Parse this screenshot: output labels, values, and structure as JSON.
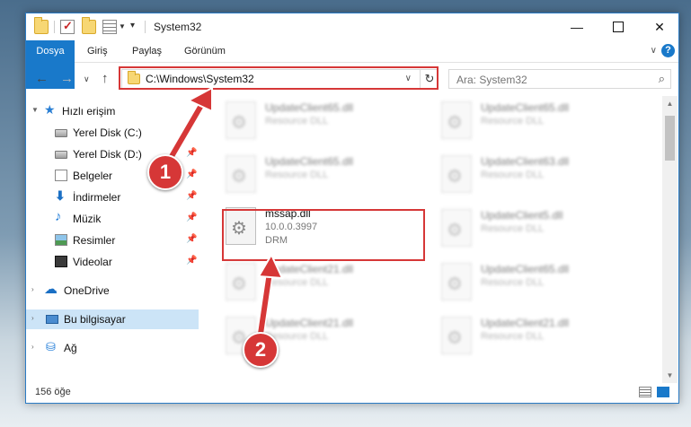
{
  "window": {
    "title": "System32"
  },
  "ribbon": {
    "tabs": [
      "Dosya",
      "Giriş",
      "Paylaş",
      "Görünüm"
    ],
    "help": "?"
  },
  "nav": {
    "address": "C:\\Windows\\System32",
    "search_placeholder": "Ara: System32"
  },
  "sidebar": {
    "items": [
      {
        "label": "Hızlı erişim",
        "icon": "star-icon"
      },
      {
        "label": "Yerel Disk (C:)",
        "icon": "disk-icon"
      },
      {
        "label": "Yerel Disk (D:)",
        "icon": "disk-icon"
      },
      {
        "label": "Belgeler",
        "icon": "document-icon"
      },
      {
        "label": "İndirmeler",
        "icon": "download-icon"
      },
      {
        "label": "Müzik",
        "icon": "music-icon"
      },
      {
        "label": "Resimler",
        "icon": "pictures-icon"
      },
      {
        "label": "Videolar",
        "icon": "video-icon"
      },
      {
        "label": "OneDrive",
        "icon": "cloud-icon"
      },
      {
        "label": "Bu bilgisayar",
        "icon": "computer-icon"
      },
      {
        "label": "Ağ",
        "icon": "network-icon"
      }
    ]
  },
  "files": {
    "highlighted": {
      "name": "mssap.dll",
      "version": "10.0.0.3997",
      "type": "DRM"
    },
    "blurred": [
      {
        "name": "UpdateClient65.dll",
        "type": "Resource DLL"
      },
      {
        "name": "UpdateClient65.dll",
        "type": "Resource DLL"
      },
      {
        "name": "UpdateClient65.dll",
        "type": "Resource DLL"
      },
      {
        "name": "UpdateClient63.dll",
        "type": "Resource DLL"
      },
      {
        "name": "UpdateClient5.dll",
        "type": "Resource DLL"
      },
      {
        "name": "UpdateClient21.dll",
        "type": "Resource DLL"
      },
      {
        "name": "UpdateClient65.dll",
        "type": "Resource DLL"
      },
      {
        "name": "UpdateClient21.dll",
        "type": "Resource DLL"
      },
      {
        "name": "UpdateClient21.dll",
        "type": "Resource DLL"
      }
    ]
  },
  "status": {
    "count": "156 öğe"
  },
  "annotations": {
    "step1": "1",
    "step2": "2",
    "accent_color": "#d63737"
  }
}
